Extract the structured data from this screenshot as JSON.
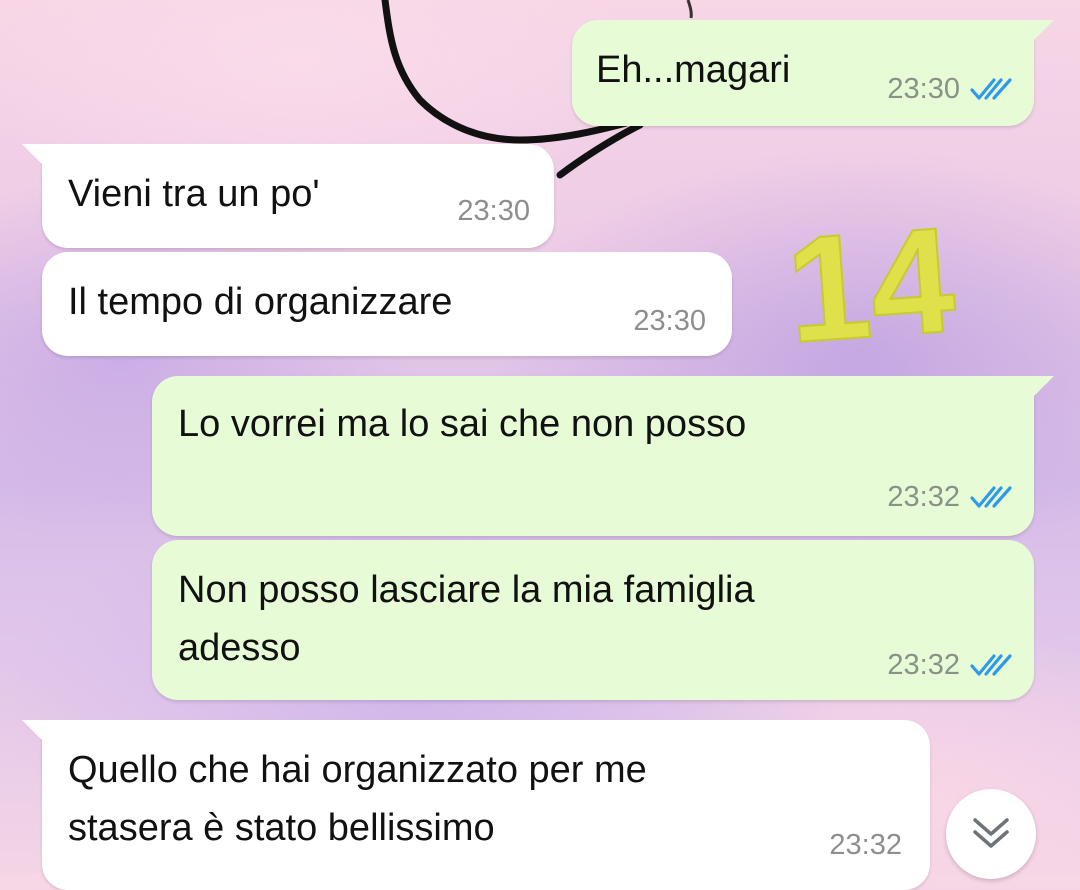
{
  "colors": {
    "outgoing_bubble": "#e7fcd6",
    "incoming_bubble": "#ffffff",
    "read_check": "#2f9be8",
    "sticker_number": "#dfe04a"
  },
  "sticker": {
    "text": "14"
  },
  "messages": [
    {
      "direction": "outgoing",
      "lines": [
        "Eh...magari"
      ],
      "time": "23:30",
      "status": "read",
      "status_icon": "double-check-icon"
    },
    {
      "direction": "incoming",
      "lines": [
        "Vieni tra un po'"
      ],
      "time": "23:30"
    },
    {
      "direction": "incoming",
      "lines": [
        "Il tempo di organizzare"
      ],
      "time": "23:30"
    },
    {
      "direction": "outgoing",
      "lines": [
        "Lo vorrei ma lo sai che non posso"
      ],
      "time": "23:32",
      "status": "read",
      "status_icon": "double-check-icon"
    },
    {
      "direction": "outgoing",
      "lines": [
        "Non posso lasciare la mia famiglia",
        "adesso"
      ],
      "time": "23:32",
      "status": "read",
      "status_icon": "double-check-icon"
    },
    {
      "direction": "incoming",
      "lines": [
        "Quello che hai organizzato per me",
        "stasera è stato bellissimo"
      ],
      "time": "23:32"
    }
  ],
  "scroll_button": {
    "icon": "double-chevron-down-icon"
  }
}
